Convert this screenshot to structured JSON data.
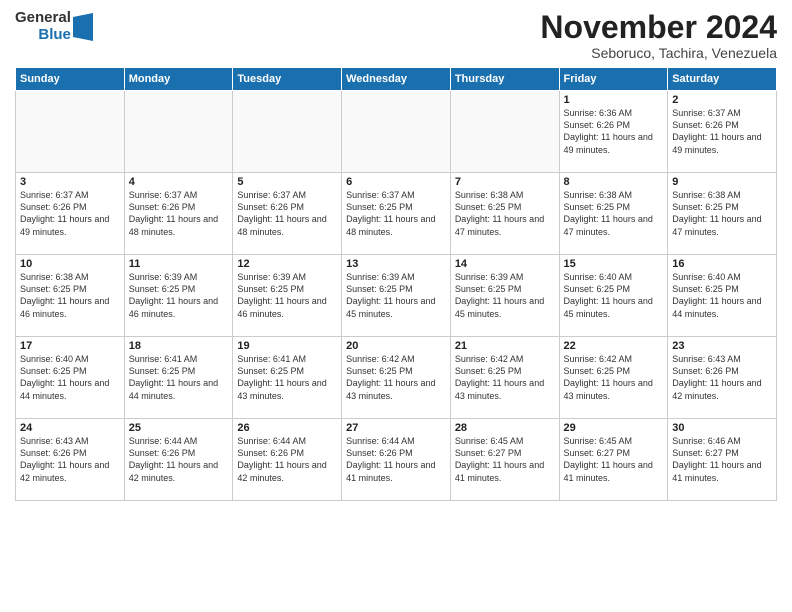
{
  "logo": {
    "general": "General",
    "blue": "Blue"
  },
  "title": "November 2024",
  "location": "Seboruco, Tachira, Venezuela",
  "headers": [
    "Sunday",
    "Monday",
    "Tuesday",
    "Wednesday",
    "Thursday",
    "Friday",
    "Saturday"
  ],
  "weeks": [
    [
      {
        "day": "",
        "info": ""
      },
      {
        "day": "",
        "info": ""
      },
      {
        "day": "",
        "info": ""
      },
      {
        "day": "",
        "info": ""
      },
      {
        "day": "",
        "info": ""
      },
      {
        "day": "1",
        "info": "Sunrise: 6:36 AM\nSunset: 6:26 PM\nDaylight: 11 hours and 49 minutes."
      },
      {
        "day": "2",
        "info": "Sunrise: 6:37 AM\nSunset: 6:26 PM\nDaylight: 11 hours and 49 minutes."
      }
    ],
    [
      {
        "day": "3",
        "info": "Sunrise: 6:37 AM\nSunset: 6:26 PM\nDaylight: 11 hours and 49 minutes."
      },
      {
        "day": "4",
        "info": "Sunrise: 6:37 AM\nSunset: 6:26 PM\nDaylight: 11 hours and 48 minutes."
      },
      {
        "day": "5",
        "info": "Sunrise: 6:37 AM\nSunset: 6:26 PM\nDaylight: 11 hours and 48 minutes."
      },
      {
        "day": "6",
        "info": "Sunrise: 6:37 AM\nSunset: 6:25 PM\nDaylight: 11 hours and 48 minutes."
      },
      {
        "day": "7",
        "info": "Sunrise: 6:38 AM\nSunset: 6:25 PM\nDaylight: 11 hours and 47 minutes."
      },
      {
        "day": "8",
        "info": "Sunrise: 6:38 AM\nSunset: 6:25 PM\nDaylight: 11 hours and 47 minutes."
      },
      {
        "day": "9",
        "info": "Sunrise: 6:38 AM\nSunset: 6:25 PM\nDaylight: 11 hours and 47 minutes."
      }
    ],
    [
      {
        "day": "10",
        "info": "Sunrise: 6:38 AM\nSunset: 6:25 PM\nDaylight: 11 hours and 46 minutes."
      },
      {
        "day": "11",
        "info": "Sunrise: 6:39 AM\nSunset: 6:25 PM\nDaylight: 11 hours and 46 minutes."
      },
      {
        "day": "12",
        "info": "Sunrise: 6:39 AM\nSunset: 6:25 PM\nDaylight: 11 hours and 46 minutes."
      },
      {
        "day": "13",
        "info": "Sunrise: 6:39 AM\nSunset: 6:25 PM\nDaylight: 11 hours and 45 minutes."
      },
      {
        "day": "14",
        "info": "Sunrise: 6:39 AM\nSunset: 6:25 PM\nDaylight: 11 hours and 45 minutes."
      },
      {
        "day": "15",
        "info": "Sunrise: 6:40 AM\nSunset: 6:25 PM\nDaylight: 11 hours and 45 minutes."
      },
      {
        "day": "16",
        "info": "Sunrise: 6:40 AM\nSunset: 6:25 PM\nDaylight: 11 hours and 44 minutes."
      }
    ],
    [
      {
        "day": "17",
        "info": "Sunrise: 6:40 AM\nSunset: 6:25 PM\nDaylight: 11 hours and 44 minutes."
      },
      {
        "day": "18",
        "info": "Sunrise: 6:41 AM\nSunset: 6:25 PM\nDaylight: 11 hours and 44 minutes."
      },
      {
        "day": "19",
        "info": "Sunrise: 6:41 AM\nSunset: 6:25 PM\nDaylight: 11 hours and 43 minutes."
      },
      {
        "day": "20",
        "info": "Sunrise: 6:42 AM\nSunset: 6:25 PM\nDaylight: 11 hours and 43 minutes."
      },
      {
        "day": "21",
        "info": "Sunrise: 6:42 AM\nSunset: 6:25 PM\nDaylight: 11 hours and 43 minutes."
      },
      {
        "day": "22",
        "info": "Sunrise: 6:42 AM\nSunset: 6:25 PM\nDaylight: 11 hours and 43 minutes."
      },
      {
        "day": "23",
        "info": "Sunrise: 6:43 AM\nSunset: 6:26 PM\nDaylight: 11 hours and 42 minutes."
      }
    ],
    [
      {
        "day": "24",
        "info": "Sunrise: 6:43 AM\nSunset: 6:26 PM\nDaylight: 11 hours and 42 minutes."
      },
      {
        "day": "25",
        "info": "Sunrise: 6:44 AM\nSunset: 6:26 PM\nDaylight: 11 hours and 42 minutes."
      },
      {
        "day": "26",
        "info": "Sunrise: 6:44 AM\nSunset: 6:26 PM\nDaylight: 11 hours and 42 minutes."
      },
      {
        "day": "27",
        "info": "Sunrise: 6:44 AM\nSunset: 6:26 PM\nDaylight: 11 hours and 41 minutes."
      },
      {
        "day": "28",
        "info": "Sunrise: 6:45 AM\nSunset: 6:27 PM\nDaylight: 11 hours and 41 minutes."
      },
      {
        "day": "29",
        "info": "Sunrise: 6:45 AM\nSunset: 6:27 PM\nDaylight: 11 hours and 41 minutes."
      },
      {
        "day": "30",
        "info": "Sunrise: 6:46 AM\nSunset: 6:27 PM\nDaylight: 11 hours and 41 minutes."
      }
    ]
  ]
}
